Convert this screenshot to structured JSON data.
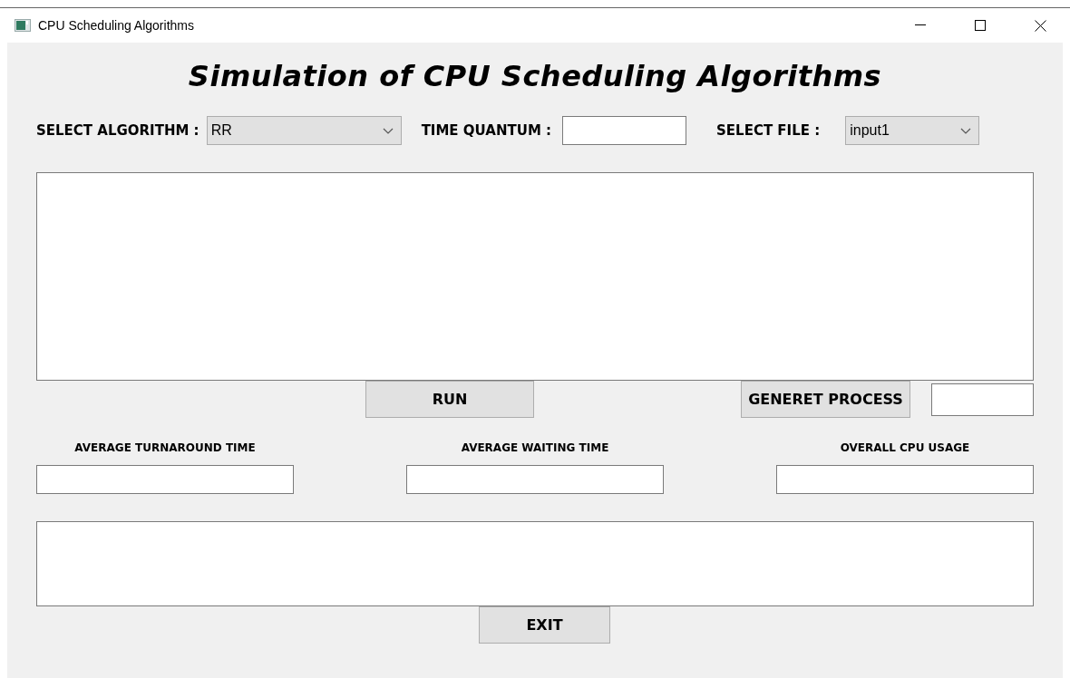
{
  "window": {
    "title": "CPU Scheduling Algorithms"
  },
  "heading": "Simulation of CPU Scheduling Algorithms",
  "algorithm": {
    "label": "SELECT ALGORITHM :",
    "value": "RR"
  },
  "time_quantum": {
    "label": "TIME QUANTUM :"
  },
  "file": {
    "label": "SELECT FILE :",
    "value": "input1"
  },
  "run_button": "RUN",
  "generate_button": "GENERET PROCESS",
  "stats": [
    {
      "label": "AVERAGE TURNAROUND TIME"
    },
    {
      "label": "AVERAGE WAITING TIME"
    },
    {
      "label": "OVERALL CPU USAGE"
    }
  ],
  "exit_button": "EXIT"
}
